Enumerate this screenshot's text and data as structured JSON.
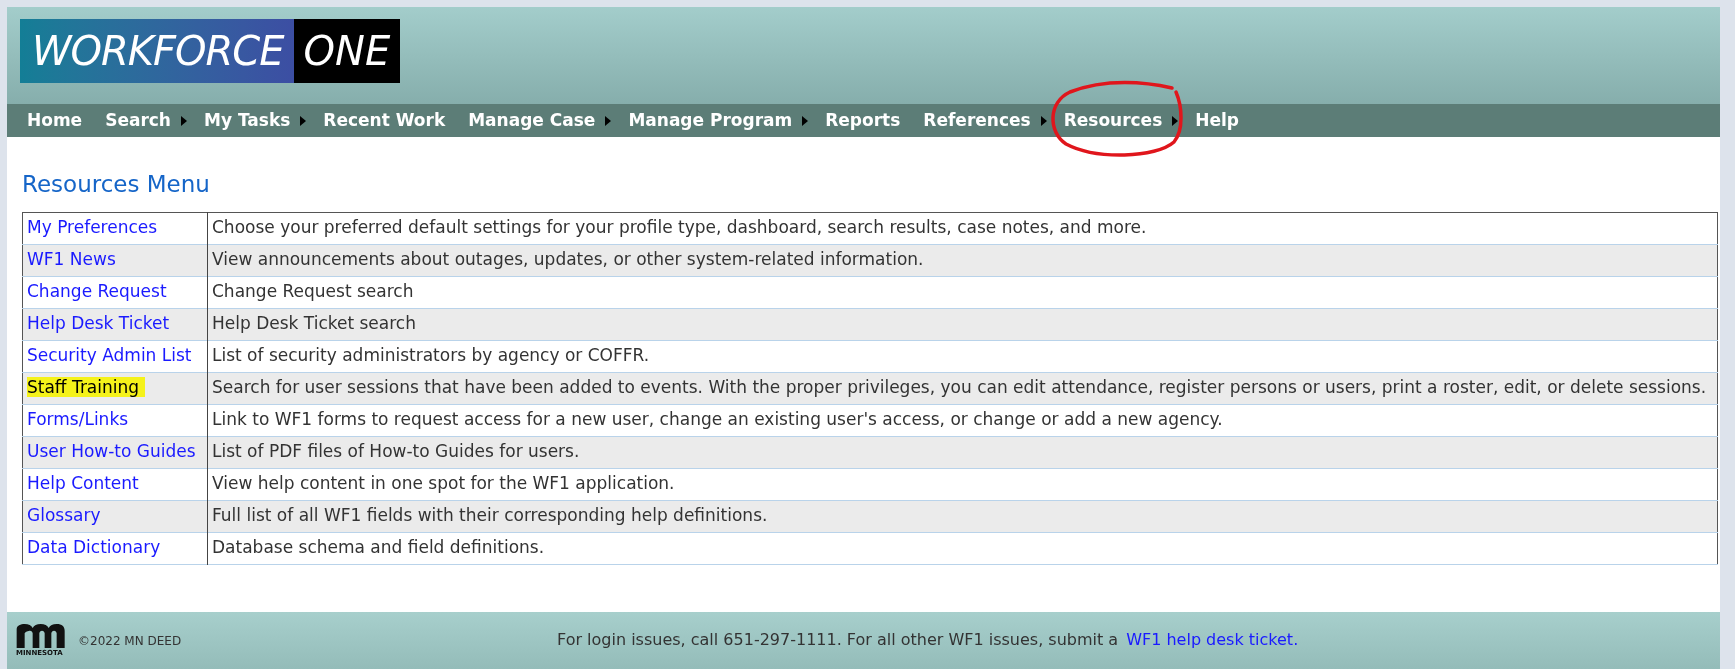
{
  "logo": {
    "left": "WORKFORCE",
    "right": "ONE"
  },
  "nav": [
    {
      "label": "Home",
      "has_submenu": false,
      "circled": false
    },
    {
      "label": "Search",
      "has_submenu": true,
      "circled": false
    },
    {
      "label": "My Tasks",
      "has_submenu": true,
      "circled": false
    },
    {
      "label": "Recent Work",
      "has_submenu": false,
      "circled": false
    },
    {
      "label": "Manage Case",
      "has_submenu": true,
      "circled": false
    },
    {
      "label": "Manage Program",
      "has_submenu": true,
      "circled": false
    },
    {
      "label": "Reports",
      "has_submenu": false,
      "circled": false
    },
    {
      "label": "References",
      "has_submenu": true,
      "circled": false
    },
    {
      "label": "Resources",
      "has_submenu": true,
      "circled": true
    },
    {
      "label": "Help",
      "has_submenu": false,
      "circled": false
    }
  ],
  "heading": "Resources Menu",
  "rows": [
    {
      "link": "My Preferences",
      "description": "Choose your preferred default settings for your profile type, dashboard, search results, case notes, and more.",
      "highlighted": false
    },
    {
      "link": "WF1 News",
      "description": "View announcements about outages, updates, or other system-related information.",
      "highlighted": false
    },
    {
      "link": "Change Request",
      "description": "Change Request search",
      "highlighted": false
    },
    {
      "link": "Help Desk Ticket",
      "description": "Help Desk Ticket search",
      "highlighted": false
    },
    {
      "link": "Security Admin List",
      "description": "List of security administrators by agency or COFFR.",
      "highlighted": false
    },
    {
      "link": "Staff Training",
      "description": "Search for user sessions that have been added to events. With the proper privileges, you can edit attendance, register persons or users, print a roster, edit, or delete sessions.",
      "highlighted": true
    },
    {
      "link": "Forms/Links",
      "description": "Link to WF1 forms to request access for a new user, change an existing user's access, or change or add a new agency.",
      "highlighted": false
    },
    {
      "link": "User How-to Guides",
      "description": "List of PDF files of How-to Guides for users.",
      "highlighted": false
    },
    {
      "link": "Help Content",
      "description": "View help content in one spot for the WF1 application.",
      "highlighted": false
    },
    {
      "link": "Glossary",
      "description": "Full list of all WF1 fields with their corresponding help definitions.",
      "highlighted": false
    },
    {
      "link": "Data Dictionary",
      "description": "Database schema and field definitions.",
      "highlighted": false
    }
  ],
  "footer": {
    "logo_caption": "MINNESOTA",
    "copyright": "©2022 MN DEED",
    "message": "For login issues, call 651-297-1111. For all other WF1 issues, submit a",
    "link": "WF1 help desk ticket."
  }
}
